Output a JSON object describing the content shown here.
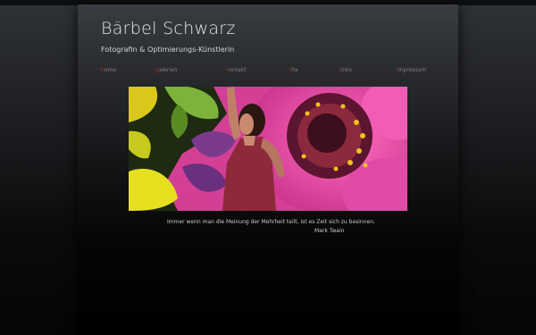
{
  "site": {
    "title": "Bärbel Schwarz",
    "subtitle": "Fotografin & Optimierungs-Künstlerin"
  },
  "nav": {
    "items": [
      {
        "first": "h",
        "rest": "ome"
      },
      {
        "first": "g",
        "rest": "alerien"
      },
      {
        "first": "k",
        "rest": "ontakt"
      },
      {
        "first": "t",
        "rest": "hx"
      },
      {
        "first": "l",
        "rest": "inks"
      },
      {
        "first": "i",
        "rest": "mpressum"
      }
    ]
  },
  "hero": {
    "subject": "woman with raised arm in front of a pink zinnia flower"
  },
  "quote": {
    "text": "Immer wenn man die Meinung der Mehrheit teilt, ist es Zeit sich zu besinnen.",
    "author": "Mark Twain"
  },
  "colors": {
    "nav_initial": "#b1252b",
    "nav_text": "#7f7f7f",
    "title": "#e6e6e6"
  }
}
